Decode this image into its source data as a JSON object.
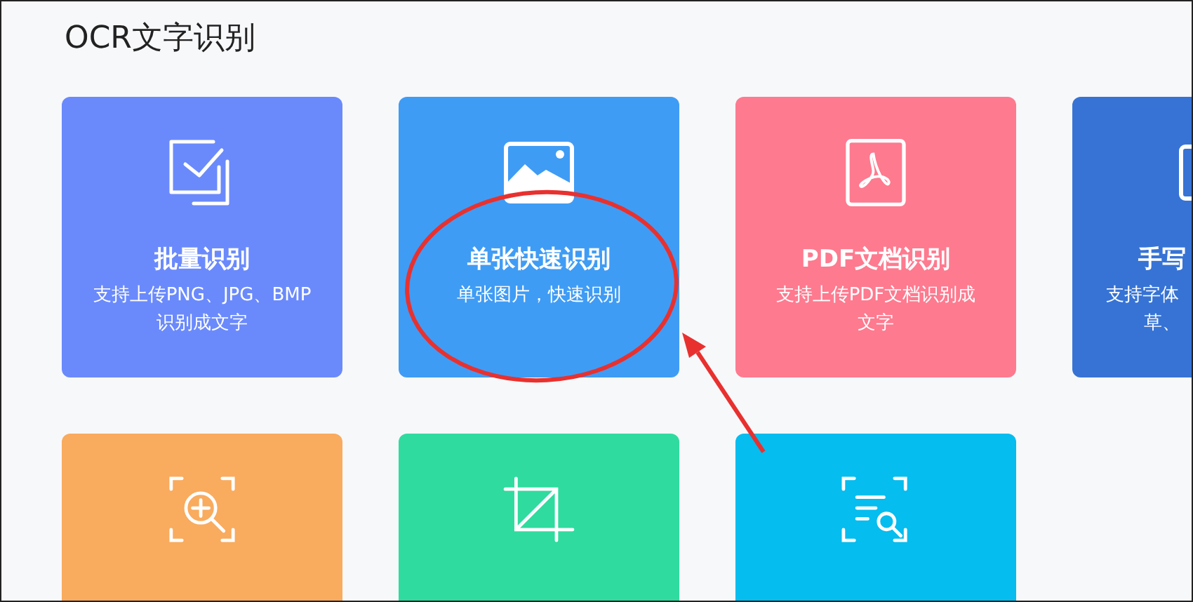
{
  "title": "OCR文字识别",
  "cards": [
    {
      "kind": "batch",
      "color": "#6a8afc",
      "title": "批量识别",
      "description": [
        "支持上传PNG、JPG、BMP",
        "识别成文字"
      ]
    },
    {
      "kind": "image",
      "color": "#3f9cf5",
      "title": "单张快速识别",
      "description": [
        "单张图片，快速识别"
      ]
    },
    {
      "kind": "pdf",
      "color": "#fe7a8f",
      "title": "PDF文档识别",
      "description": [
        "支持上传PDF文档识别成",
        "文字"
      ]
    },
    {
      "kind": "handwriting",
      "color": "#3673d5",
      "partial": true,
      "title": "手写",
      "description": [
        "支持字体",
        "草、"
      ]
    },
    {
      "kind": "zoom",
      "color": "#f9ab5e"
    },
    {
      "kind": "crop",
      "color": "#2fdb9f"
    },
    {
      "kind": "scan",
      "color": "#05bdee"
    }
  ],
  "annotation": {
    "kind": "ellipse_with_arrow"
  }
}
